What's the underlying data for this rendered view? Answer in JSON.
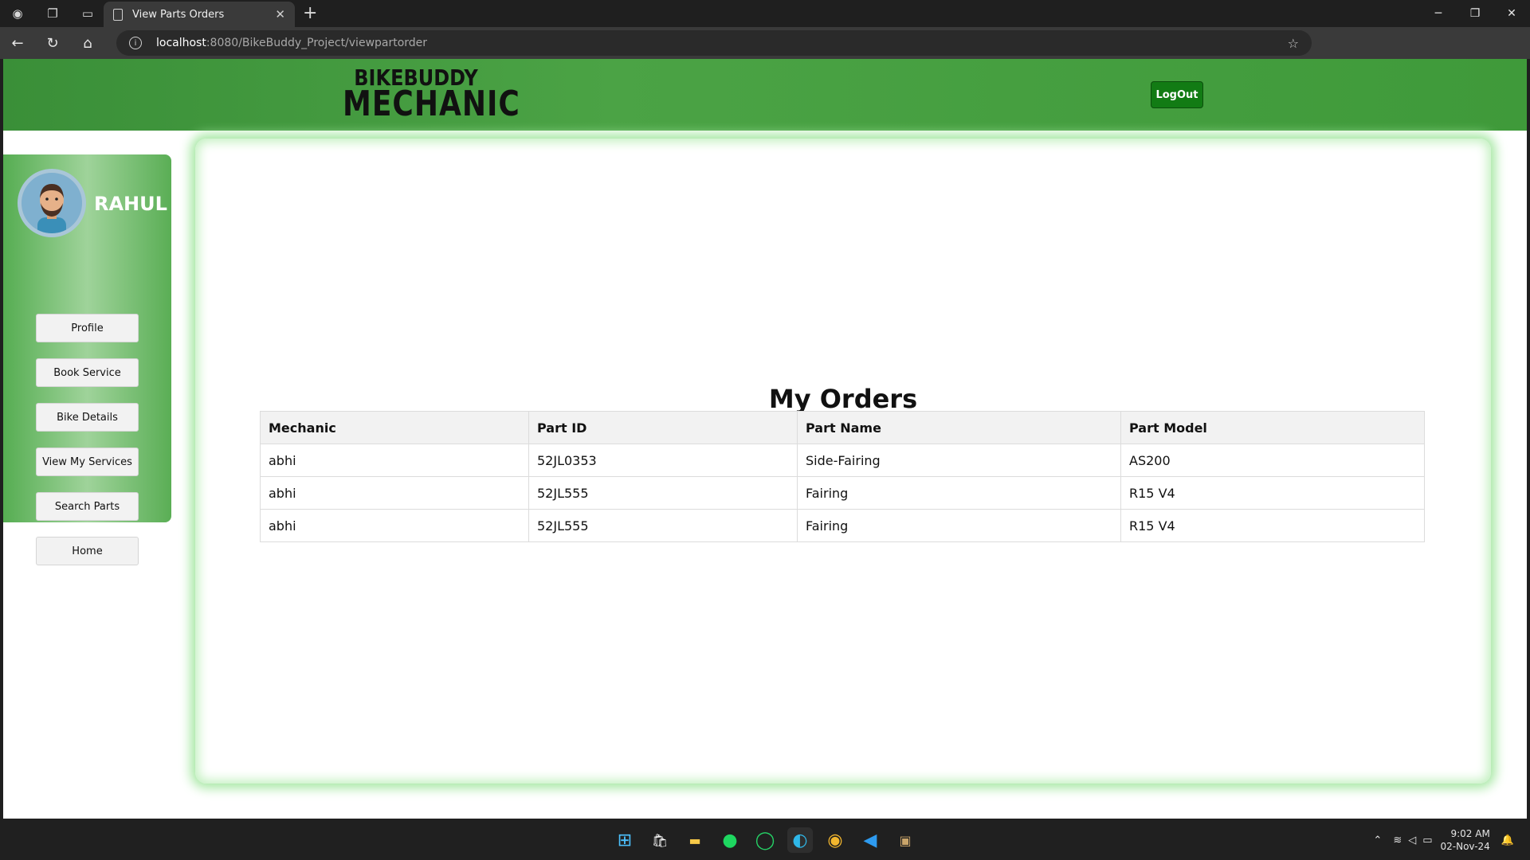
{
  "browser": {
    "tab_title": "View Parts Orders",
    "url_host": "localhost",
    "url_path": ":8080/BikeBuddy_Project/viewpartorder",
    "new_tab": "+",
    "tab_close": "✕"
  },
  "header": {
    "logo_line1": "BIKEBUDDY",
    "logo_line2": "MECHANIC",
    "logout_label": "LogOut"
  },
  "sidebar": {
    "username": "RAHUL",
    "items": [
      {
        "label": "Profile"
      },
      {
        "label": "Book Service"
      },
      {
        "label": "Bike Details"
      },
      {
        "label": "View My Services"
      },
      {
        "label": "Search Parts"
      },
      {
        "label": "Home"
      }
    ]
  },
  "main": {
    "title": "My Orders",
    "columns": [
      "Mechanic",
      "Part ID",
      "Part Name",
      "Part Model"
    ],
    "rows": [
      [
        "abhi",
        "52JL0353",
        "Side-Fairing",
        "AS200"
      ],
      [
        "abhi",
        "52JL555",
        "Fairing",
        "R15 V4"
      ],
      [
        "abhi",
        "52JL555",
        "Fairing",
        "R15 V4"
      ]
    ]
  },
  "taskbar": {
    "time": "9:02 AM",
    "date": "02-Nov-24"
  },
  "colors": {
    "header_green": "#4ba345",
    "logout_green": "#127b14",
    "glow": "#a7e8a4"
  }
}
